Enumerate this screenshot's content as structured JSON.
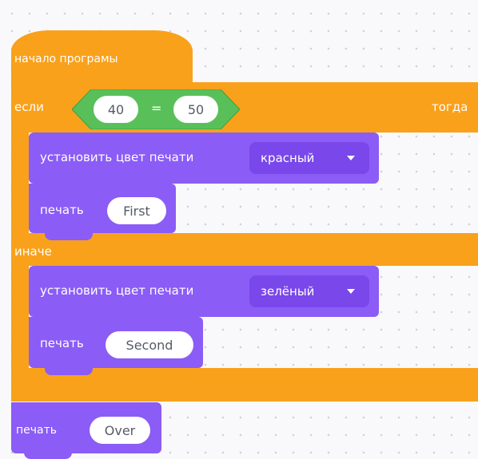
{
  "colors": {
    "control": "#f9a11b",
    "control_dark": "#e3890b",
    "looks": "#8b5cf6",
    "looks_dark": "#7a47ea",
    "operator": "#59c059",
    "operator_dark": "#3e9f3e",
    "pill_text": "#555b66"
  },
  "blocks": {
    "start": {
      "label": "начало програмы"
    },
    "if_else": {
      "if_label": "если",
      "then_label": "тогда",
      "else_label": "иначе",
      "condition": {
        "left": "40",
        "operator": "=",
        "right": "50"
      }
    },
    "set_color_1": {
      "label": "установить цвет печати",
      "value": "красный"
    },
    "print_1": {
      "label": "печать",
      "value": "First"
    },
    "set_color_2": {
      "label": "установить цвет печати",
      "value": "зелёный"
    },
    "print_2": {
      "label": "печать",
      "value": "Second"
    },
    "print_3": {
      "label": "печать",
      "value": "Over"
    }
  }
}
